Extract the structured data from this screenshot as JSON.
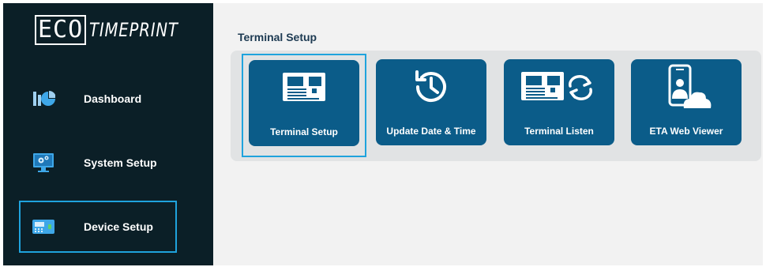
{
  "app": {
    "logo_left": "ECO",
    "logo_right": "TIMEPRINT"
  },
  "sidebar": {
    "items": [
      {
        "label": "Dashboard",
        "icon": "dashboard-chart-icon"
      },
      {
        "label": "System Setup",
        "icon": "monitor-gears-icon"
      },
      {
        "label": "Device Setup",
        "icon": "device-terminal-icon",
        "selected": true
      }
    ]
  },
  "main": {
    "title": "Terminal Setup",
    "tiles": [
      {
        "label": "Terminal Setup",
        "icon": "terminal-icon",
        "selected": true
      },
      {
        "label": "Update Date & Time",
        "icon": "clock-history-icon"
      },
      {
        "label": "Terminal Listen",
        "icon": "terminal-sync-icon"
      },
      {
        "label": "ETA Web Viewer",
        "icon": "phone-user-cloud-icon"
      }
    ]
  },
  "colors": {
    "sidebar_bg": "#0b1f27",
    "tile_bg": "#0b5c89",
    "selection_border": "#1fa3dd",
    "title_text": "#1d3a52"
  }
}
